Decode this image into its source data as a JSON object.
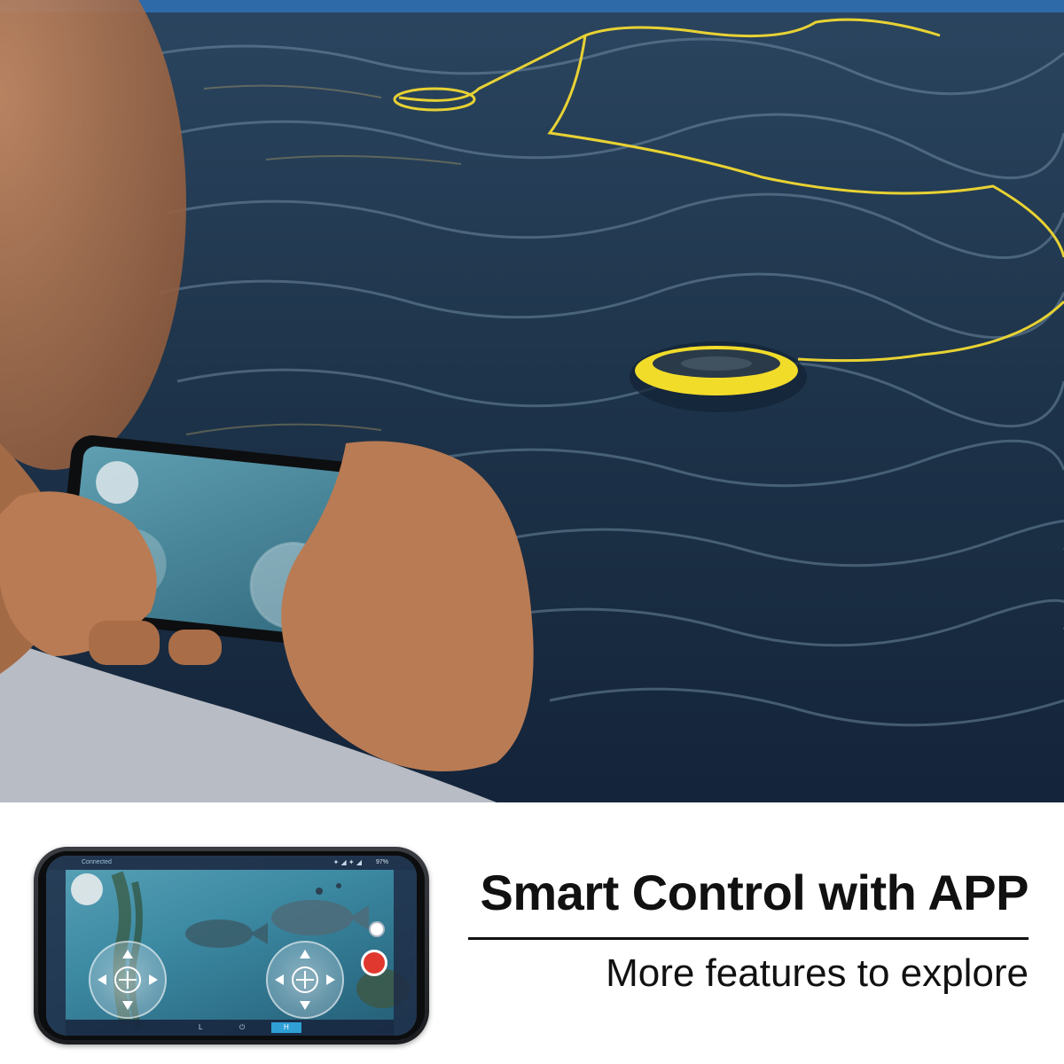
{
  "headline": "Smart Control with APP",
  "subline": "More features to explore",
  "app_ui": {
    "status_connected": "Connected",
    "status_battery": "97%",
    "mode_low": "L",
    "mode_high": "H",
    "power_glyph": "⏻"
  },
  "colors": {
    "water": "#1c3146",
    "drone_yellow": "#f2dc2a",
    "record_red": "#e0382e",
    "mode_blue": "#2f9fd6",
    "text": "#111111"
  }
}
